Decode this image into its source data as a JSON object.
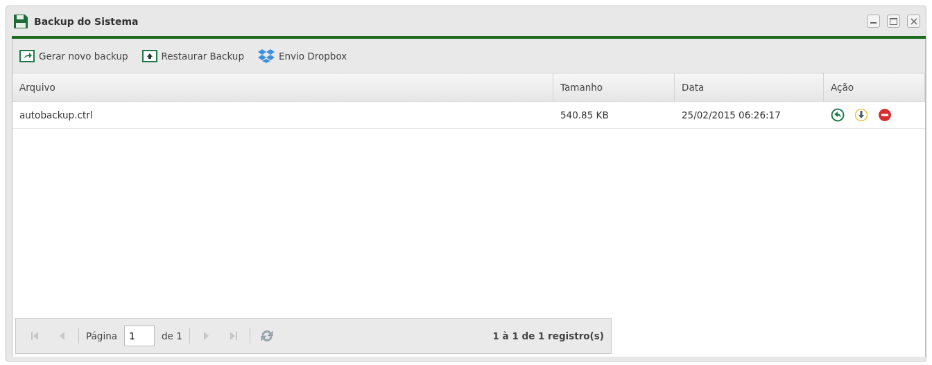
{
  "window": {
    "title": "Backup do Sistema"
  },
  "toolbar": [
    {
      "kind": "generate",
      "label": "Gerar novo backup"
    },
    {
      "kind": "restore",
      "label": "Restaurar Backup"
    },
    {
      "kind": "dropbox",
      "label": "Envio Dropbox"
    }
  ],
  "table": {
    "columns": [
      "Arquivo",
      "Tamanho",
      "Data",
      "Ação"
    ],
    "rows": [
      {
        "file": "autobackup.ctrl",
        "size": "540.85 KB",
        "date": "25/02/2015 06:26:17",
        "actions": [
          {
            "kind": "restore"
          },
          {
            "kind": "download"
          },
          {
            "kind": "delete"
          }
        ]
      }
    ]
  },
  "pager": {
    "first": {
      "disabled": true
    },
    "prev": {
      "disabled": true
    },
    "page_label": "Página",
    "page": "1",
    "of": "de 1",
    "next": {
      "disabled": true
    },
    "last": {
      "disabled": true
    },
    "summary": "1 à 1 de 1 registro(s)"
  }
}
